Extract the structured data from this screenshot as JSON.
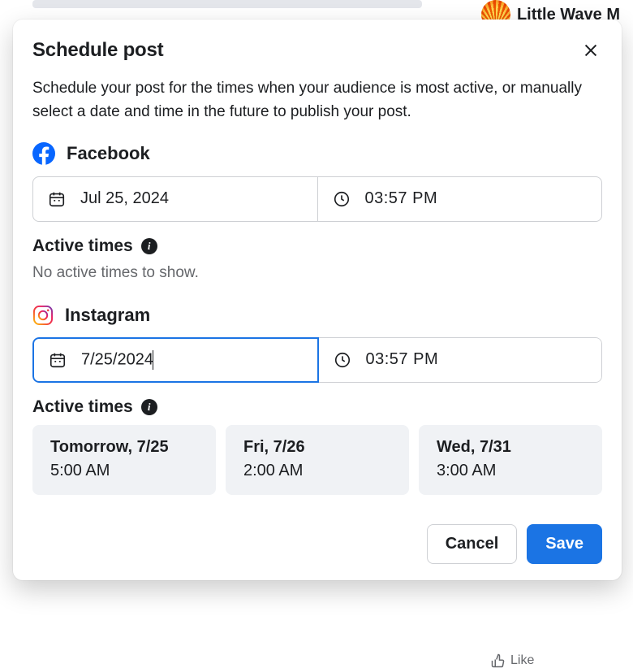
{
  "background": {
    "page_name": "Little Wave M",
    "like_label": "Like"
  },
  "modal": {
    "title": "Schedule post",
    "description": "Schedule your post for the times when your audience is most active, or manually select a date and time in the future to publish your post."
  },
  "facebook": {
    "label": "Facebook",
    "date": "Jul 25, 2024",
    "time": "03:57 PM",
    "active_times_label": "Active times",
    "no_active": "No active times to show."
  },
  "instagram": {
    "label": "Instagram",
    "date": "7/25/2024",
    "time": "03:57 PM",
    "active_times_label": "Active times",
    "suggestions": [
      {
        "day": "Tomorrow, 7/25",
        "time": "5:00 AM"
      },
      {
        "day": "Fri, 7/26",
        "time": "2:00 AM"
      },
      {
        "day": "Wed, 7/31",
        "time": "3:00 AM"
      }
    ]
  },
  "footer": {
    "cancel": "Cancel",
    "save": "Save"
  }
}
